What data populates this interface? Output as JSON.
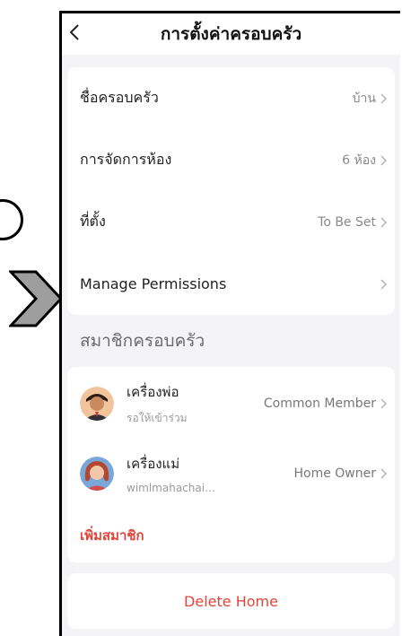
{
  "header": {
    "title": "การตั้งค่าครอบครัว"
  },
  "settings": {
    "rows": [
      {
        "label": "ชื่อครอบครัว",
        "value": "บ้าน"
      },
      {
        "label": "การจัดการห้อง",
        "value": "6 ห้อง"
      },
      {
        "label": "ที่ตั้ง",
        "value": "To Be Set"
      },
      {
        "label": "Manage Permissions",
        "value": ""
      }
    ]
  },
  "members_section": {
    "title": "สมาชิกครอบครัว",
    "members": [
      {
        "name": "เครื่องพ่อ",
        "sub": "รอให้เข้าร่วม",
        "role": "Common Member"
      },
      {
        "name": "เครื่องแม่",
        "sub": "wimlmahachai@g...",
        "role": "Home Owner"
      }
    ],
    "add_label": "เพิ่มสมาชิก"
  },
  "actions": {
    "delete_label": "Delete Home"
  },
  "colors": {
    "accent_red": "#e0453a",
    "background": "#f4f4f6"
  }
}
